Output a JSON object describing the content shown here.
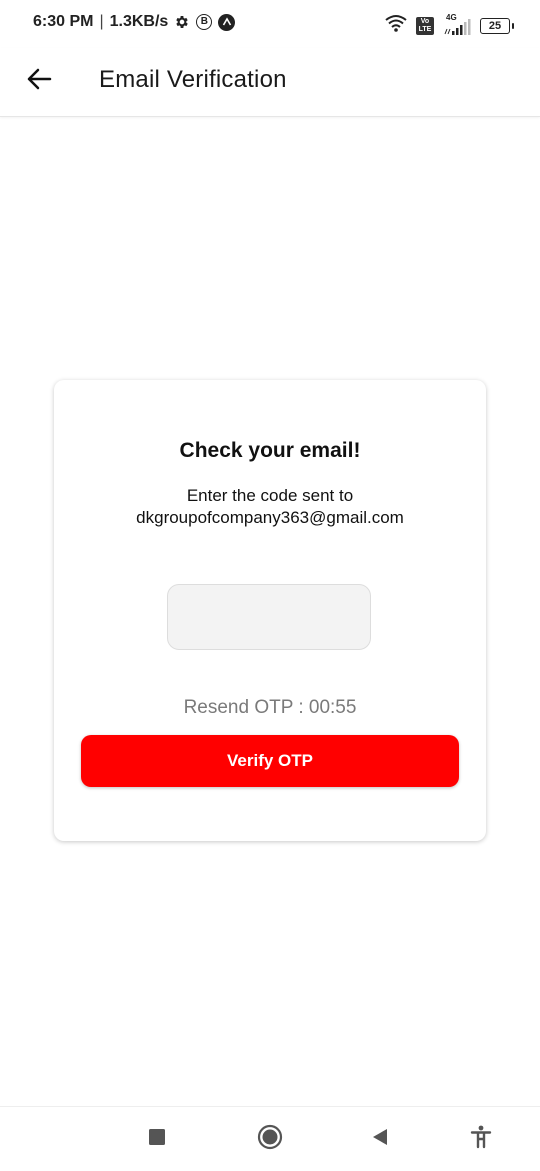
{
  "status_bar": {
    "time": "6:30 PM",
    "separator": "|",
    "speed": "1.3KB/s",
    "b_badge": "B",
    "network_type": "4G",
    "volte": "Vo LTE",
    "battery": "25"
  },
  "app_bar": {
    "title": "Email Verification"
  },
  "card": {
    "heading": "Check your email!",
    "subtext_line1": "Enter the code sent to",
    "email": "dkgroupofcompany363@gmail.com",
    "otp_value": "",
    "resend_text": "Resend OTP : 00:55",
    "verify_label": "Verify OTP"
  },
  "colors": {
    "primary": "#ff0000",
    "input_bg": "#f3f3f3",
    "muted_text": "#7a7a7a"
  },
  "icons": {
    "back": "arrow-left-icon",
    "settings": "gear-icon",
    "wifi": "wifi-icon",
    "signal": "signal-icon",
    "nav_recents": "square-icon",
    "nav_home": "circle-icon",
    "nav_back": "triangle-left-icon",
    "nav_accessibility": "accessibility-icon"
  }
}
